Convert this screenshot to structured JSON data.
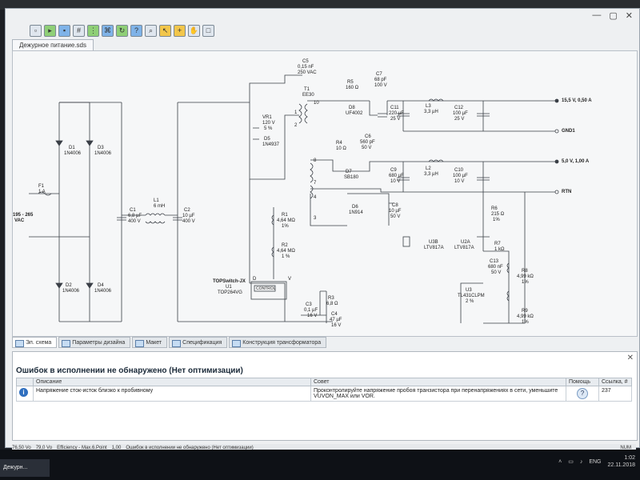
{
  "app": {
    "document_tab": "Дежурное питание.sds"
  },
  "diagram": {
    "labels": {
      "c5": "C5",
      "c5v": "0,15 nF",
      "c5r": "250 VAC",
      "t1": "T1",
      "t1c": "EE30",
      "r5": "R5",
      "r5v": "160 Ω",
      "c7": "C7",
      "c7v": "68 pF",
      "c7r": "100 V",
      "d8": "D8",
      "d8p": "UF4002",
      "l3": "L3",
      "l3v": "3,3 µH",
      "c11": "C11",
      "c11v": "220 µF",
      "c11r": "25 V",
      "c12": "C12",
      "c12v": "100 µF",
      "c12r": "25 V",
      "out1": "15,5 V, 0,50 A",
      "gnd1": "GND1",
      "vr1": "VR1",
      "vr1v": "120 V",
      "vr1t": "5 %",
      "d5": "D5",
      "d5p": "1N4937",
      "r4": "R4",
      "r4v": "10 Ω",
      "c6": "C6",
      "c6v": "560 pF",
      "c6r": "50 V",
      "d7": "D7",
      "d7p": "SB180",
      "l2": "L2",
      "l2v": "3,3 µH",
      "c9": "C9",
      "c9v": "680 µF",
      "c9r": "10 V",
      "c10": "C10",
      "c10v": "100 µF",
      "c10r": "10 V",
      "out2": "5,0 V, 1,00 A",
      "rtn": "RTN",
      "d1": "D1",
      "d1p": "1N4006",
      "d3": "D3",
      "d3p": "1N4006",
      "d2": "D2",
      "d2p": "1N4006",
      "d4": "D4",
      "d4p": "1N4006",
      "f1": "F1",
      "f1v": "1 A",
      "vin": "195 - 265",
      "vinu": "VAC",
      "c1": "C1",
      "c1v": "6,8 µF",
      "c1r": "400 V",
      "l1": "L1",
      "l1v": "6 mH",
      "c2": "C2",
      "c2v": "10 µF",
      "c2r": "400 V",
      "r1": "R1",
      "r1v": "4,64 MΩ",
      "r1t": "1%",
      "r2": "R2",
      "r2v": "4,64 MΩ",
      "r2t": "1 %",
      "d6": "D6",
      "d6p": "1N914",
      "c8": "C8",
      "c8v": "10 µF",
      "c8r": "50 V",
      "u3b": "U3B",
      "u3bp": "LTV817A",
      "r6": "R6",
      "r6v": "215 Ω",
      "r6t": "1%",
      "u2a": "U2A",
      "u2ap": "LTV817A",
      "r7": "R7",
      "r7v": "1 kΩ",
      "c13": "C13",
      "c13v": "680 nF",
      "c13r": "50 V",
      "r8": "R8",
      "r8v": "4,99 kΩ",
      "r8t": "1%",
      "u3": "U3",
      "u3p": "TL431CLPM",
      "u3t": "2 %",
      "r9": "R9",
      "r9v": "4,99 kΩ",
      "r9t": "1%",
      "ic": "TOPSwitch-JX",
      "u1": "U1",
      "u1p": "TOP264VG",
      "ctrl": "CONTROL",
      "r3": "R3",
      "r3v": "6,8 Ω",
      "c3": "C3",
      "c3v": "0,1 µF",
      "c3r": "16 V",
      "c4": "C4",
      "c4v": "47 µF",
      "c4r": "16 V",
      "p10": "10",
      "p1": "1",
      "p2": "2",
      "p8": "8",
      "p7": "7",
      "p4": "4",
      "p3": "3",
      "pd": "D",
      "pv": "V"
    }
  },
  "bottom_tabs": [
    "Эл. схема",
    "Параметры дизайна",
    "Макет",
    "Спецификация",
    "Конструкция трансформатора"
  ],
  "messages": {
    "title": "Ошибок в исполнении не обнаружено (Нет оптимизации)",
    "columns": {
      "description": "Описание",
      "advice": "Совет",
      "help": "Помощь",
      "link": "Ссылка, #"
    },
    "row": {
      "description": "Напряжение сток-исток близко к пробивному",
      "advice": "Проконтролируйте напряжение пробоя транзистора при перенапряжениях в сети, уменьшите VUVON_MAX или VOR.",
      "help_icon": "question-icon",
      "link": "237"
    }
  },
  "statusbar": {
    "items": [
      "76,50 Vo",
      "79,0 Vo",
      "Efficiency - Max.6.Point",
      "1,00",
      "Ошибок в исполнении не обнаружено (Нет оптимизации)"
    ],
    "right": "NUM"
  },
  "taskbar": {
    "app": "Дежурн...",
    "lang": "ENG",
    "time": "1:02",
    "date": "22.11.2018"
  },
  "colors": {
    "wire": "#3a3f46",
    "window_bg": "#eef0f2",
    "canvas_bg": "#f6f7f8",
    "info": "#2f6fbf"
  }
}
